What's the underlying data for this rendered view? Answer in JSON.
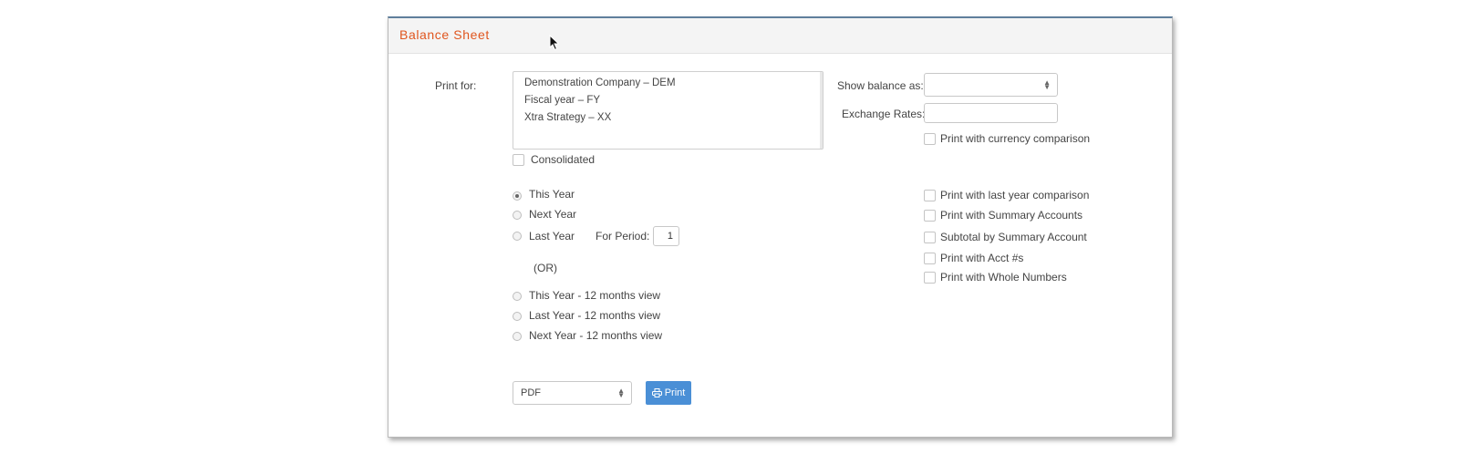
{
  "panel": {
    "title": "Balance Sheet"
  },
  "print_for": {
    "label": "Print for:",
    "options": [
      "Demonstration Company – DEM",
      "Fiscal year – FY",
      "Xtra Strategy – XX"
    ]
  },
  "consolidated_label": "Consolidated",
  "periods": {
    "this_year": "This Year",
    "next_year": "Next Year",
    "last_year": "Last Year",
    "for_period_label": "For Period:",
    "for_period_value": "1",
    "or_label": "(OR)",
    "this_year_12": "This Year - 12 months view",
    "last_year_12": "Last Year - 12 months view",
    "next_year_12": "Next Year - 12 months view",
    "selected": "This Year"
  },
  "show_balance": {
    "label": "Show balance as:",
    "value": ""
  },
  "exchange_rates": {
    "label": "Exchange Rates:",
    "value": ""
  },
  "options": {
    "currency_comparison": "Print with currency comparison",
    "last_year_comparison": "Print with last year comparison",
    "summary_accounts": "Print with Summary Accounts",
    "subtotal_summary": "Subtotal by Summary Account",
    "acct_numbers": "Print with Acct #s",
    "whole_numbers": "Print with Whole Numbers"
  },
  "format_select": {
    "value": "PDF"
  },
  "print_button": {
    "label": "Print",
    "icon": "printer-icon"
  }
}
